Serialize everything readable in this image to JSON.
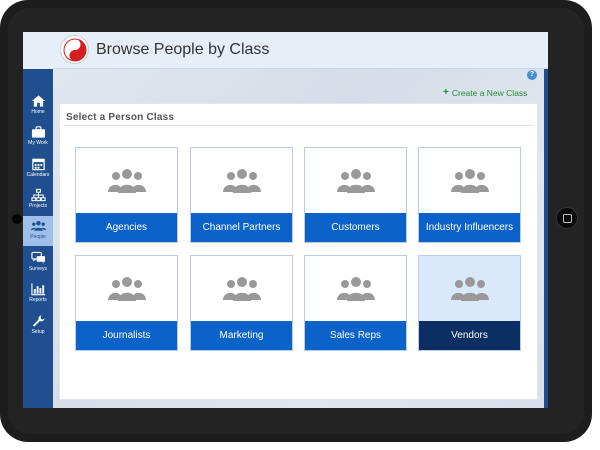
{
  "header": {
    "title": "Browse People by Class"
  },
  "sidebar": {
    "items": [
      {
        "label": "Home",
        "icon": "home-icon"
      },
      {
        "label": "My Work",
        "icon": "briefcase-icon"
      },
      {
        "label": "Calendars",
        "icon": "calendar-icon"
      },
      {
        "label": "Projects",
        "icon": "hierarchy-icon"
      },
      {
        "label": "People",
        "icon": "people-icon",
        "active": true
      },
      {
        "label": "Surveys",
        "icon": "chat-bubbles-icon"
      },
      {
        "label": "Reports",
        "icon": "bar-chart-icon"
      },
      {
        "label": "Setup",
        "icon": "wrench-icon"
      }
    ]
  },
  "actions": {
    "help": "?",
    "create_label": "Create a New Class",
    "create_icon": "+"
  },
  "panel": {
    "title": "Select a Person Class"
  },
  "classes": [
    {
      "label": "Agencies"
    },
    {
      "label": "Channel Partners"
    },
    {
      "label": "Customers"
    },
    {
      "label": "Industry Influencers"
    },
    {
      "label": "Journalists"
    },
    {
      "label": "Marketing"
    },
    {
      "label": "Sales Reps"
    },
    {
      "label": "Vendors",
      "selected": true
    }
  ],
  "colors": {
    "accent": "#0b62c9",
    "selected": "#0b2f63",
    "sidebar": "#1f4f8f",
    "link": "#2a8a3a"
  }
}
